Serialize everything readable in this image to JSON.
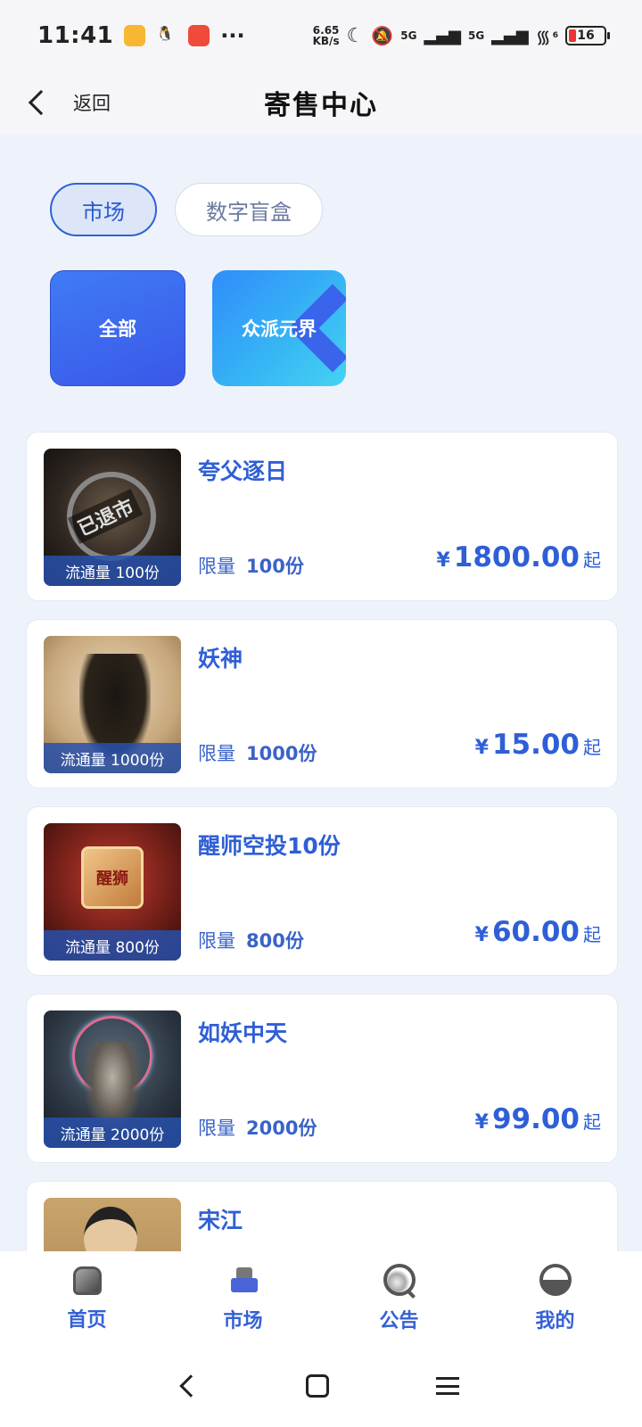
{
  "status_bar": {
    "time": "11:41",
    "more": "···",
    "net_speed_value": "6.65",
    "net_speed_unit": "KB/s",
    "signal1": "5G",
    "signal2": "5G",
    "wifi_sub": "6",
    "battery": "16"
  },
  "header": {
    "back_label": "返回",
    "title": "寄售中心"
  },
  "tabs": [
    {
      "label": "市场",
      "active": true
    },
    {
      "label": "数字盲盒",
      "active": false
    }
  ],
  "categories": [
    {
      "label": "全部"
    },
    {
      "label": "众派元界"
    }
  ],
  "items": [
    {
      "title": "夸父逐日",
      "circulation": "流通量 100份",
      "limit_label": "限量",
      "limit_value": "100份",
      "currency": "¥",
      "price": "1800.00",
      "suffix": "起",
      "badge": "已退市"
    },
    {
      "title": "妖神",
      "circulation": "流通量 1000份",
      "limit_label": "限量",
      "limit_value": "1000份",
      "currency": "¥",
      "price": "15.00",
      "suffix": "起"
    },
    {
      "title": "醒师空投10份",
      "circulation": "流通量 800份",
      "limit_label": "限量",
      "limit_value": "800份",
      "currency": "¥",
      "price": "60.00",
      "suffix": "起",
      "art_text": "醒狮"
    },
    {
      "title": "如妖中天",
      "circulation": "流通量 2000份",
      "limit_label": "限量",
      "limit_value": "2000份",
      "currency": "¥",
      "price": "99.00",
      "suffix": "起"
    },
    {
      "title": "宋江"
    }
  ],
  "tabbar": [
    {
      "label": "首页",
      "icon": "home-icon"
    },
    {
      "label": "市场",
      "icon": "market-icon"
    },
    {
      "label": "公告",
      "icon": "notice-icon"
    },
    {
      "label": "我的",
      "icon": "profile-icon"
    }
  ],
  "colors": {
    "accent": "#2f5fd6",
    "background": "#eef3fb"
  }
}
